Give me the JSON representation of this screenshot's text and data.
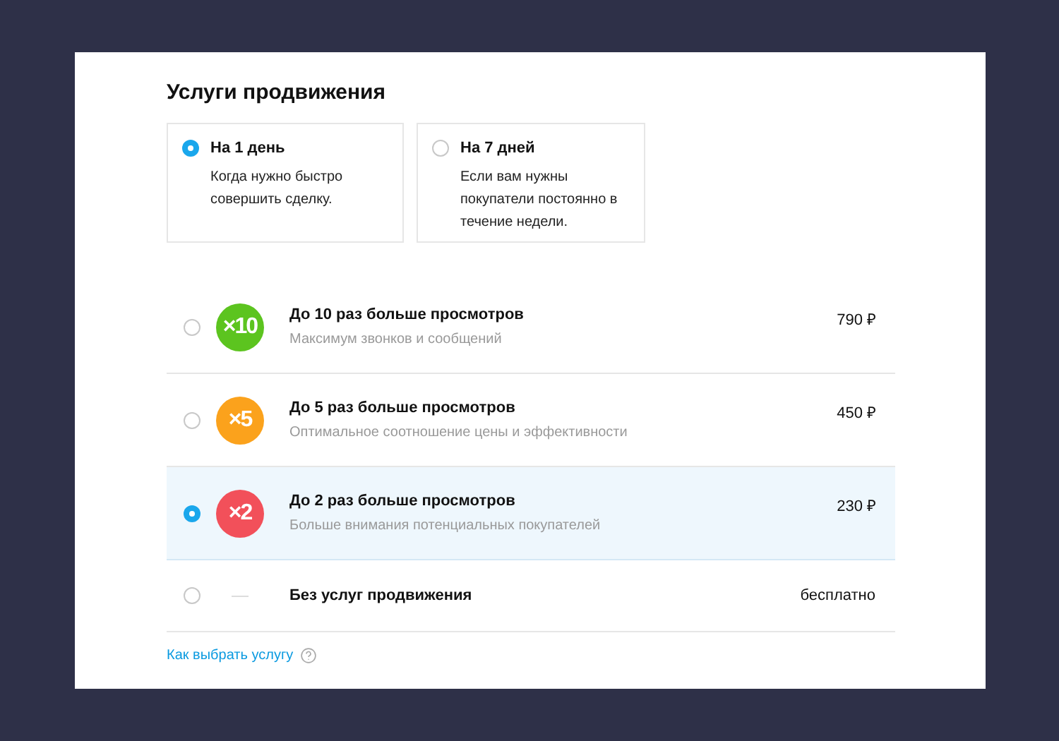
{
  "title": "Услуги продвижения",
  "durations": [
    {
      "label": "На 1 день",
      "description": "Когда нужно быстро совершить сделку.",
      "selected": true
    },
    {
      "label": "На 7 дней",
      "description": "Если вам нужны покупатели постоянно в течение недели.",
      "selected": false
    }
  ],
  "options": [
    {
      "kind": "badge",
      "badge": "×10",
      "color": "#5cc41f",
      "title": "До 10 раз больше просмотров",
      "subtitle": "Максимум звонков и сообщений",
      "price": "790 ₽",
      "selected": false
    },
    {
      "kind": "badge",
      "badge": "×5",
      "color": "#fba21c",
      "title": "До 5 раз больше просмотров",
      "subtitle": "Оптимальное соотношение цены и эффективности",
      "price": "450 ₽",
      "selected": false
    },
    {
      "kind": "badge",
      "badge": "×2",
      "color": "#f2505a",
      "title": "До 2 раз больше просмотров",
      "subtitle": "Больше внимания потенциальных покупателей",
      "price": "230 ₽",
      "selected": true
    },
    {
      "kind": "none",
      "title": "Без услуг продвижения",
      "price": "бесплатно",
      "selected": false
    }
  ],
  "help_link": "Как выбрать услугу"
}
